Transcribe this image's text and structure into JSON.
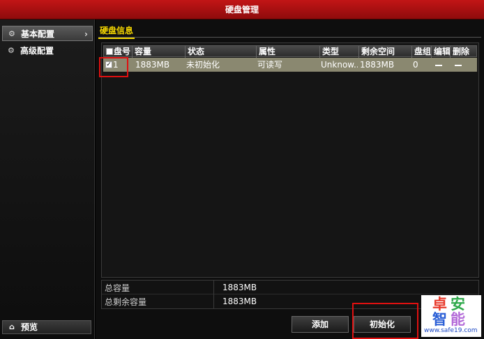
{
  "window": {
    "title": "硬盘管理"
  },
  "sidebar": {
    "items": [
      {
        "label": "基本配置",
        "icon": "gear-icon",
        "active": true
      },
      {
        "label": "高级配置",
        "icon": "gear-icon",
        "active": false
      }
    ],
    "preview_label": "预览"
  },
  "main": {
    "tab": "硬盘信息",
    "table": {
      "columns": [
        "盘号",
        "容量",
        "状态",
        "属性",
        "类型",
        "剩余空间",
        "盘组",
        "编辑",
        "删除"
      ],
      "rows": [
        {
          "checked": true,
          "disk_no": "1",
          "capacity": "1883MB",
          "status": "未初始化",
          "attribute": "可读写",
          "type": "Unknow...",
          "free_space": "1883MB",
          "group": "0"
        }
      ]
    },
    "summary": {
      "total_capacity_label": "总容量",
      "total_capacity_value": "1883MB",
      "total_free_label": "总剩余容量",
      "total_free_value": "1883MB"
    },
    "buttons": {
      "add": "添加",
      "init": "初始化"
    }
  },
  "watermark": {
    "chars": [
      "卓",
      "安",
      "智",
      "能"
    ],
    "url": "www.safe19.com"
  },
  "colors": {
    "title_bar": "#c21516",
    "tab_accent": "#f5d600",
    "selected_row": "#8a8870",
    "highlight_box": "#e01010"
  }
}
